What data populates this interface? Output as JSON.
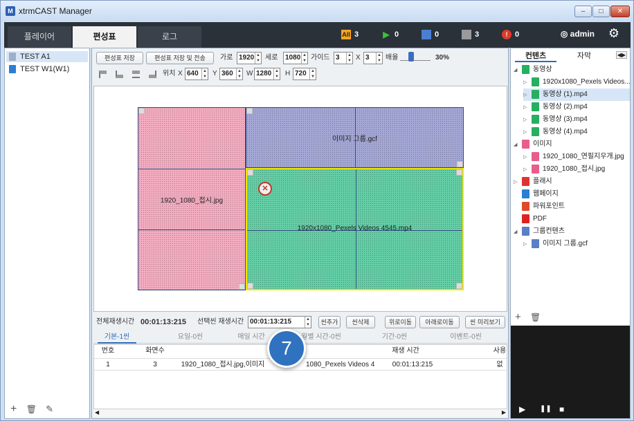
{
  "window": {
    "title": "xtrmCAST Manager",
    "logo": "M",
    "minimize": "–",
    "maximize": "□",
    "close": "✕"
  },
  "tabs": [
    {
      "label": "플레이어"
    },
    {
      "label": "편성표"
    },
    {
      "label": "로그"
    }
  ],
  "status": [
    {
      "icon": "all-icon",
      "badge": "All",
      "count": "3",
      "color": "#f5a623"
    },
    {
      "icon": "play-icon",
      "count": "0",
      "color": "#3ec13e"
    },
    {
      "icon": "stop-blue-icon",
      "count": "0",
      "color": "#4a7fd4"
    },
    {
      "icon": "stop-gray-icon",
      "count": "3",
      "color": "#9a9a9a"
    },
    {
      "icon": "alert-icon",
      "count": "0",
      "color": "#e03a2a"
    }
  ],
  "user": {
    "name": "admin"
  },
  "left": {
    "items": [
      {
        "label": "TEST A1"
      },
      {
        "label": "TEST W1(W1)"
      }
    ],
    "bottom": {
      "add": "+",
      "delete": "🗑",
      "edit": "✎"
    }
  },
  "toolbar": {
    "save": "편성표 저장",
    "save_send": "편성표 저장 및 전송",
    "width_label": "가로",
    "width_value": "1920",
    "height_label": "세로",
    "height_value": "1080",
    "guide_label": "가이드",
    "guide_x": "3",
    "guide_sep": "X",
    "guide_y": "3",
    "scale_label": "배율",
    "scale_value": "30%",
    "pos_label": "위치",
    "x_label": "X",
    "x_value": "640",
    "y_label": "Y",
    "y_value": "360",
    "w_label": "W",
    "w_value": "1280",
    "h_label": "H",
    "h_value": "720"
  },
  "canvas": {
    "regions": [
      {
        "label": "이미지 그룹.gcf",
        "color": "#a5a8d6"
      },
      {
        "label": "1920_1080_접시.jpg",
        "color": "#f4adc0"
      },
      {
        "label": "1920x1080_Pexels Videos 4545.mp4",
        "color": "#64cfa7"
      }
    ],
    "mute_icon": "✕"
  },
  "timeline": {
    "total_label": "전체재생시간",
    "total_value": "00:01:13:215",
    "scene_label": "선택씬 재생시간",
    "scene_value": "00:01:13:215",
    "buttons": [
      "씬추가",
      "씬삭제",
      "위로이동",
      "아래로이동",
      "씬 미리보기"
    ]
  },
  "subtabs": [
    "기본-1씬",
    "요일-0씬",
    "매일 시간",
    "월별 시간-0씬",
    "기간-0씬",
    "이벤트-0씬"
  ],
  "table": {
    "headers": [
      "번호",
      "화면수",
      "재생 시간",
      "사용"
    ],
    "rows": [
      {
        "num": "1",
        "screens": "3",
        "content": "1920_1080_접시.jpg,이미지",
        "content2": "1080_Pexels Videos 4...",
        "time": "00:01:13:215",
        "use": "없"
      }
    ]
  },
  "badge": "7",
  "right": {
    "tabs": [
      "컨텐츠",
      "자막"
    ],
    "tree": [
      {
        "label": "동영상",
        "depth": 0,
        "toggle": "◢",
        "color": "#27ae60"
      },
      {
        "label": "1920x1080_Pexels Videos...",
        "depth": 1,
        "toggle": "▷",
        "color": "#27ae60"
      },
      {
        "label": "동영상 (1).mp4",
        "depth": 1,
        "toggle": "▷",
        "color": "#27ae60"
      },
      {
        "label": "동영상 (2).mp4",
        "depth": 1,
        "toggle": "▷",
        "color": "#27ae60"
      },
      {
        "label": "동영상 (3).mp4",
        "depth": 1,
        "toggle": "▷",
        "color": "#27ae60"
      },
      {
        "label": "동영상 (4).mp4",
        "depth": 1,
        "toggle": "▷",
        "color": "#27ae60"
      },
      {
        "label": "이미지",
        "depth": 0,
        "toggle": "◢",
        "color": "#e85d8a"
      },
      {
        "label": "1920_1080_연필지우개.jpg",
        "depth": 1,
        "toggle": "▷",
        "color": "#e85d8a"
      },
      {
        "label": "1920_1080_접시.jpg",
        "depth": 1,
        "toggle": "▷",
        "color": "#e85d8a"
      },
      {
        "label": "플래시",
        "depth": 0,
        "toggle": "▷",
        "color": "#d33"
      },
      {
        "label": "웹페이지",
        "depth": 0,
        "toggle": "",
        "color": "#2a7fd4"
      },
      {
        "label": "파워포인트",
        "depth": 0,
        "toggle": "",
        "color": "#e04a2a"
      },
      {
        "label": "PDF",
        "depth": 0,
        "toggle": "",
        "color": "#d22"
      },
      {
        "label": "그룹컨텐츠",
        "depth": 0,
        "toggle": "◢",
        "color": "#5b7fc7"
      },
      {
        "label": "이미지 그룹.gcf",
        "depth": 1,
        "toggle": "▷",
        "color": "#5b7fc7"
      }
    ],
    "add": "+",
    "delete": "🗑",
    "controls": {
      "play": "▶",
      "pause": "❚❚",
      "stop": "■"
    }
  }
}
